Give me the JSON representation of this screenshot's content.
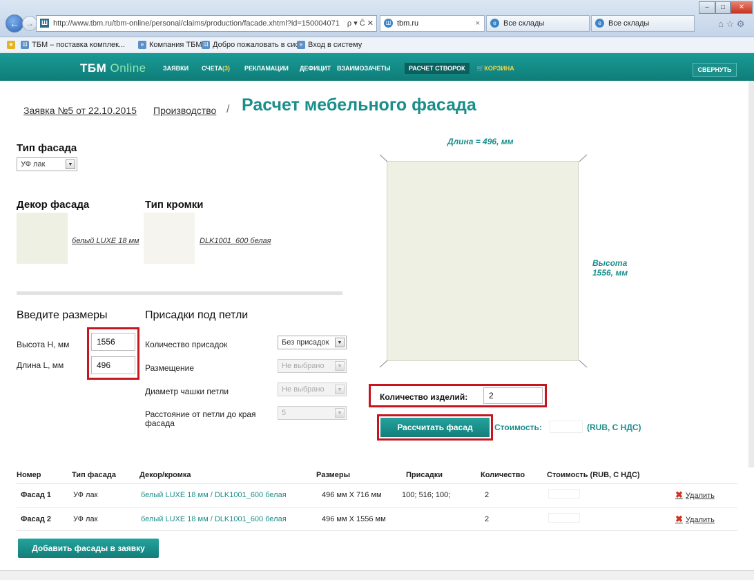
{
  "browser": {
    "url": "http://www.tbm.ru/tbm-online/personal/claims/production/facade.xhtml?id=150004071",
    "url_controls": "ρ ▾ Ĉ ✕",
    "tabs": [
      {
        "label": "tbm.ru",
        "active": true
      },
      {
        "label": "Все склады",
        "active": false
      },
      {
        "label": "Все склады",
        "active": false
      }
    ],
    "favorites": [
      "ТБМ – поставка комплек...",
      "Компания ТБМ",
      "Добро пожаловать в сис...",
      "Вход в систему"
    ]
  },
  "site": {
    "logo_main": "ТБМ",
    "logo_sub": "Online",
    "menu": [
      "ЗАЯВКИ",
      "СЧЕТА",
      "РЕКЛАМАЦИИ",
      "ДЕФИЦИТ",
      "ВЗАИМОЗАЧЕТЫ",
      "РАСЧЕТ СТВОРОК",
      "КОРЗИНА"
    ],
    "invoices_count": "(3)",
    "collapse_label": "СВЕРНУТЬ"
  },
  "page": {
    "breadcrumb_order": "Заявка №5 от 22.10.2015",
    "breadcrumb_production": "Производство",
    "breadcrumb_sep": "/",
    "title": "Расчет мебельного фасада"
  },
  "facade": {
    "type_heading": "Тип фасада",
    "type_value": "УФ лак",
    "decor_heading": "Декор фасада",
    "decor_value": "белый LUXE 18 мм",
    "edge_heading": "Тип кромки",
    "edge_value": "DLK1001_600 белая"
  },
  "sizes": {
    "heading": "Введите размеры",
    "height_label": "Высота H, мм",
    "height_value": "1556",
    "length_label": "Длина L, мм",
    "length_value": "496"
  },
  "hinges": {
    "heading": "Присадки под петли",
    "count_label": "Количество присадок",
    "count_value": "Без присадок",
    "placement_label": "Размещение",
    "placement_value": "Не выбрано",
    "cup_label": "Диаметр чашки петли",
    "cup_value": "Не выбрано",
    "distance_label": "Расстояние от петли до края фасада",
    "distance_value": "5"
  },
  "preview": {
    "length_text": "Длина = 496, мм",
    "height_text_1": "Высота",
    "height_text_2": "1556, мм",
    "color": "#eef0e4"
  },
  "calc": {
    "qty_label": "Количество изделий:",
    "qty_value": "2",
    "button_label": "Рассчитать фасад",
    "cost_label": "Стоимость:",
    "cost_unit": "(RUB, С НДС)"
  },
  "table": {
    "headers": [
      "Номер",
      "Тип фасада",
      "Декор/кромка",
      "Размеры",
      "Присадки",
      "Количество",
      "Стоимость (RUB, С НДС)"
    ],
    "rows": [
      {
        "num": "Фасад 1",
        "type": "УФ лак",
        "decor": "белый LUXE 18 мм / DLK1001_600 белая",
        "size": "496 мм X 716 мм",
        "drill": "100; 516; 100;",
        "qty": "2",
        "delete": "Удалить"
      },
      {
        "num": "Фасад 2",
        "type": "УФ лак",
        "decor": "белый LUXE 18 мм / DLK1001_600 белая",
        "size": "496 мм X 1556 мм",
        "drill": "",
        "qty": "2",
        "delete": "Удалить"
      }
    ]
  },
  "add_button_label": "Добавить фасады в заявку",
  "colors": {
    "accent": "#1a8e8a",
    "highlight": "#c8141e"
  }
}
